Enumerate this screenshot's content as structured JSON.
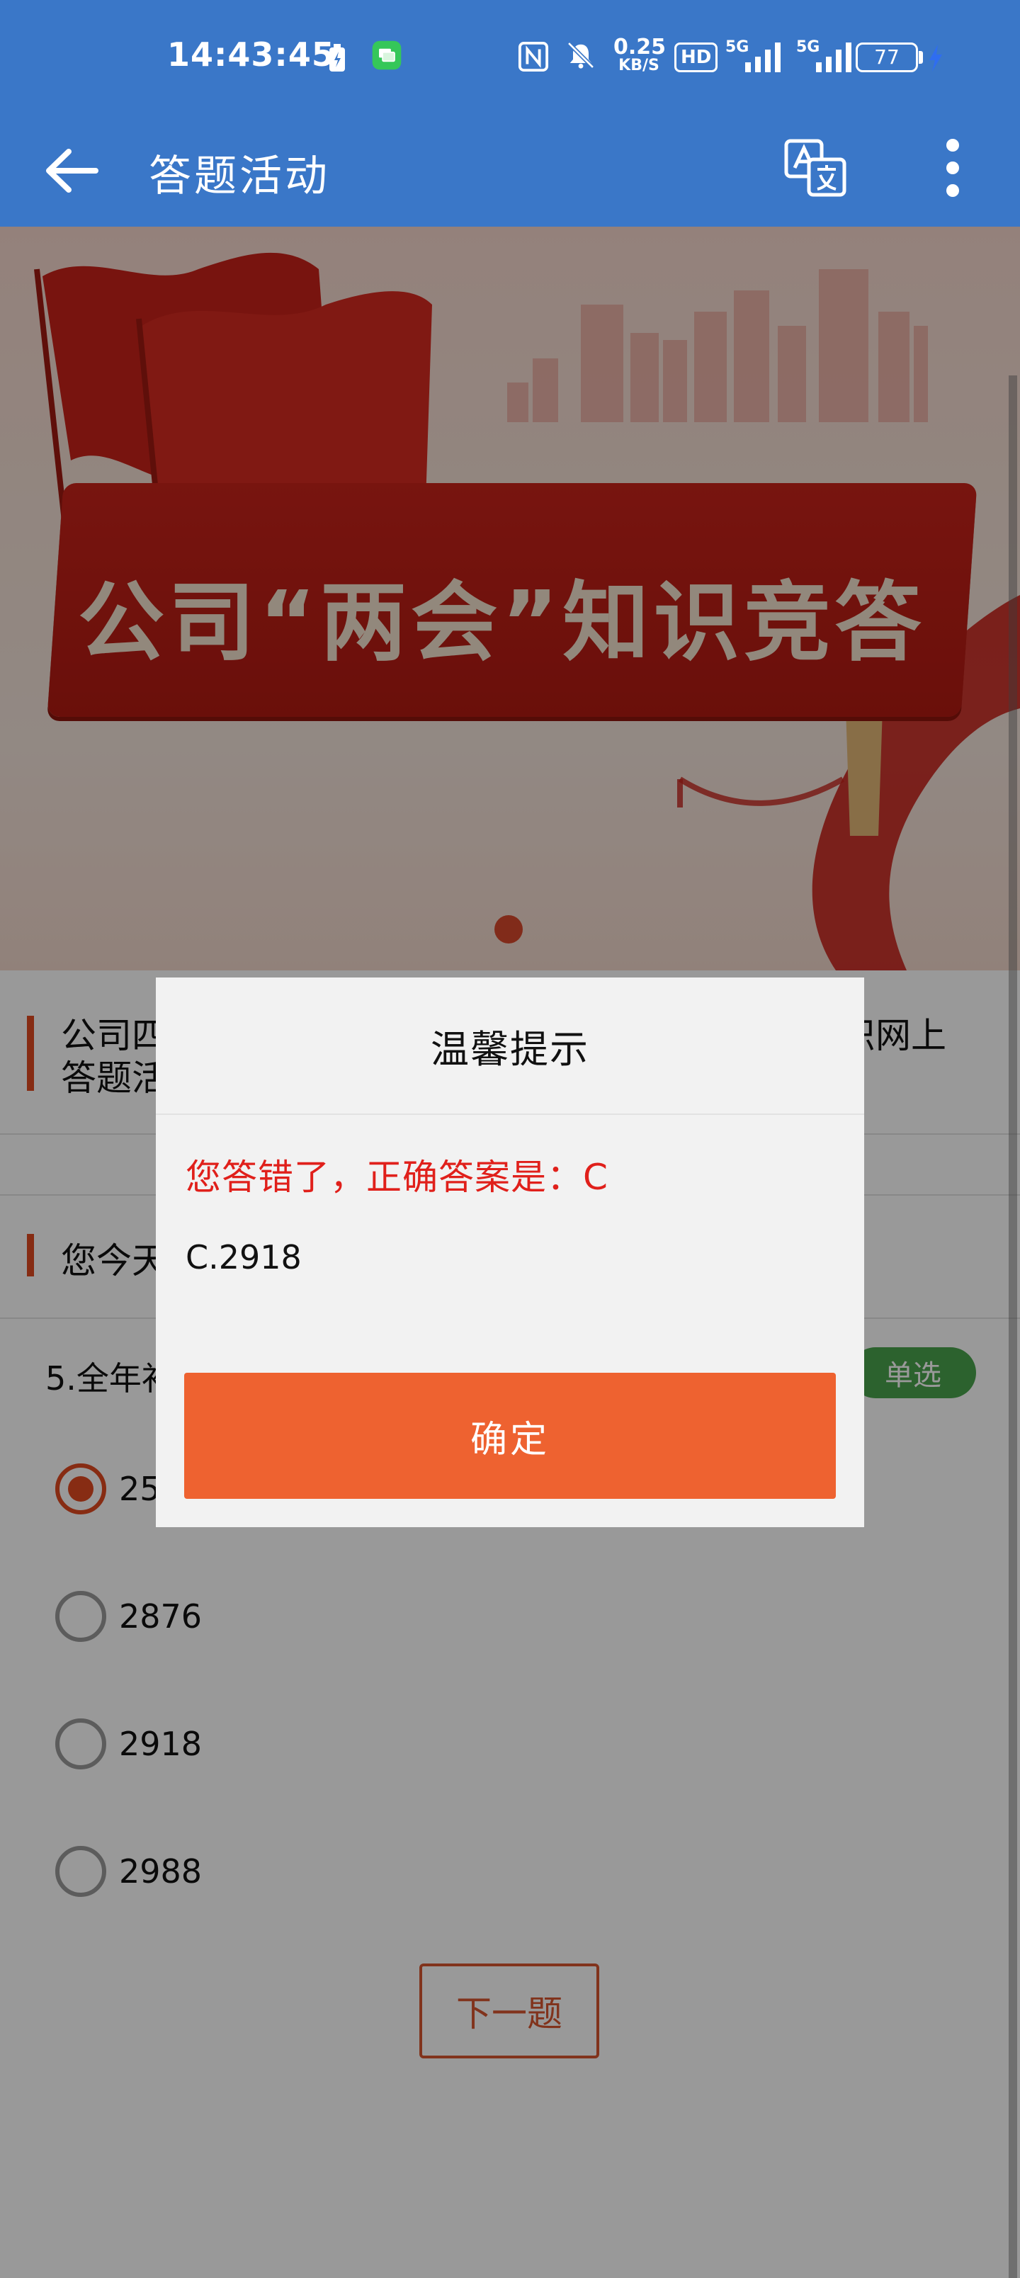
{
  "status_bar": {
    "time": "14:43:45",
    "network_speed": "0.25",
    "network_unit": "KB/S",
    "hd_label": "HD",
    "signal1_label": "5G",
    "signal2_label": "5G",
    "battery": "77",
    "icons": [
      "battery-saver-icon",
      "message-app-icon",
      "nfc-icon",
      "mute-icon",
      "hd-icon",
      "signal-icon",
      "signal-icon",
      "battery-icon",
      "charging-icon"
    ]
  },
  "app_bar": {
    "title": "答题活动",
    "icons": [
      "back-arrow-icon",
      "translate-icon",
      "more-vertical-icon"
    ]
  },
  "banner": {
    "title": "公司“两会”知识竞答"
  },
  "activity": {
    "title": "公司四届六次党代会暨四届六次职代会、工代会知识网上答题活动"
  },
  "chances": {
    "text": "您今天还有1次答题机会"
  },
  "question": {
    "text": "5.全年补充医疗保险报销金额共计（ ）万元。",
    "type_badge": "单选",
    "options": [
      {
        "label": "2568",
        "selected": true
      },
      {
        "label": "2876",
        "selected": false
      },
      {
        "label": "2918",
        "selected": false
      },
      {
        "label": "2988",
        "selected": false
      }
    ],
    "next_label": "下一题"
  },
  "dialog": {
    "title": "温馨提示",
    "error_message": "您答错了，正确答案是：C",
    "answer_text": "C.2918",
    "confirm_label": "确定"
  },
  "colors": {
    "app_bar": "#3a77c8",
    "accent": "#e14a21",
    "confirm_button": "#ee6230",
    "error_text": "#e0201b",
    "badge": "#4aa44d"
  }
}
